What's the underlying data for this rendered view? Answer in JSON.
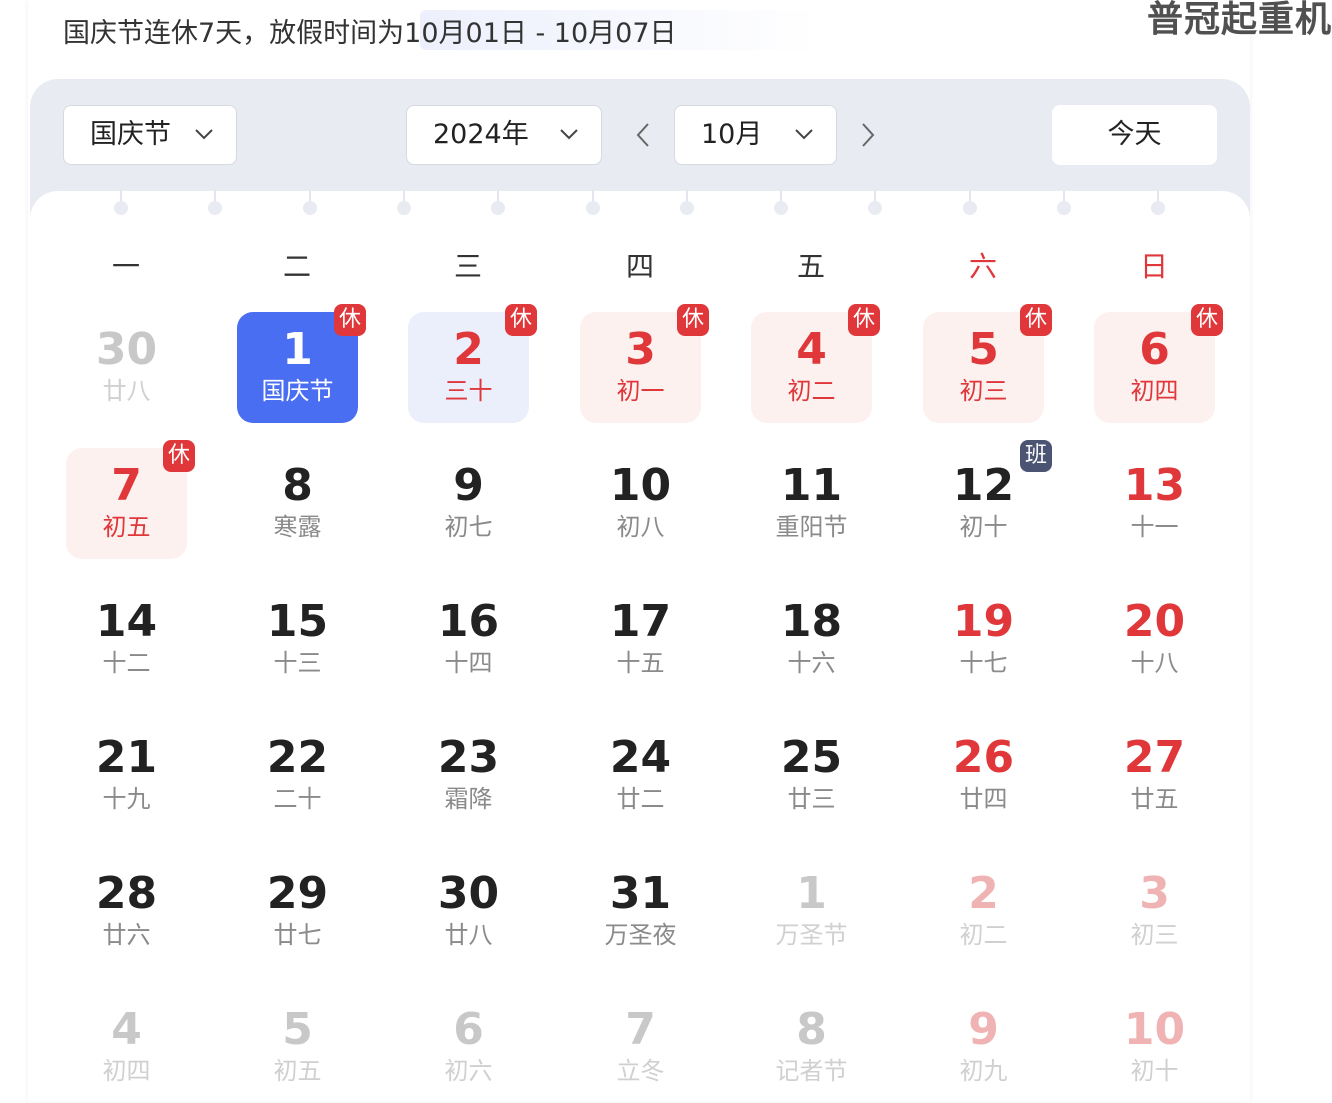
{
  "header": {
    "notice": "国庆节连休7天，放假时间为10月01日 - 10月07日",
    "watermark": "普冠起重机"
  },
  "toolbar": {
    "holiday_select": "国庆节",
    "year_select": "2024年",
    "month_select": "10月",
    "today_label": "今天",
    "prev_icon": "chevron-left-icon",
    "next_icon": "chevron-right-icon"
  },
  "weekdays": [
    "一",
    "二",
    "三",
    "四",
    "五",
    "六",
    "日"
  ],
  "badge_labels": {
    "rest": "休",
    "work": "班"
  },
  "colors": {
    "accent": "#4a6ef2",
    "holiday_red": "#e0373a",
    "holiday_bg": "#fdf1f0",
    "work_badge": "#4b5472",
    "toolbar_bg": "#e8ebf1"
  },
  "calendar": {
    "weeks": [
      [
        {
          "day": "30",
          "lunar": "廿八",
          "state": "other"
        },
        {
          "day": "1",
          "lunar": "国庆节",
          "state": "selected",
          "badge": "休"
        },
        {
          "day": "2",
          "lunar": "三十",
          "state": "selected2",
          "badge": "休"
        },
        {
          "day": "3",
          "lunar": "初一",
          "state": "holiday",
          "badge": "休"
        },
        {
          "day": "4",
          "lunar": "初二",
          "state": "holiday",
          "badge": "休"
        },
        {
          "day": "5",
          "lunar": "初三",
          "state": "holiday",
          "badge": "休"
        },
        {
          "day": "6",
          "lunar": "初四",
          "state": "holiday",
          "badge": "休"
        }
      ],
      [
        {
          "day": "7",
          "lunar": "初五",
          "state": "holiday",
          "badge": "休"
        },
        {
          "day": "8",
          "lunar": "寒露",
          "state": "normal"
        },
        {
          "day": "9",
          "lunar": "初七",
          "state": "normal"
        },
        {
          "day": "10",
          "lunar": "初八",
          "state": "normal"
        },
        {
          "day": "11",
          "lunar": "重阳节",
          "state": "normal"
        },
        {
          "day": "12",
          "lunar": "初十",
          "state": "normal",
          "badge": "班"
        },
        {
          "day": "13",
          "lunar": "十一",
          "state": "weekend"
        }
      ],
      [
        {
          "day": "14",
          "lunar": "十二",
          "state": "normal"
        },
        {
          "day": "15",
          "lunar": "十三",
          "state": "normal"
        },
        {
          "day": "16",
          "lunar": "十四",
          "state": "normal"
        },
        {
          "day": "17",
          "lunar": "十五",
          "state": "normal"
        },
        {
          "day": "18",
          "lunar": "十六",
          "state": "normal"
        },
        {
          "day": "19",
          "lunar": "十七",
          "state": "weekend"
        },
        {
          "day": "20",
          "lunar": "十八",
          "state": "weekend"
        }
      ],
      [
        {
          "day": "21",
          "lunar": "十九",
          "state": "normal"
        },
        {
          "day": "22",
          "lunar": "二十",
          "state": "normal"
        },
        {
          "day": "23",
          "lunar": "霜降",
          "state": "normal"
        },
        {
          "day": "24",
          "lunar": "廿二",
          "state": "normal"
        },
        {
          "day": "25",
          "lunar": "廿三",
          "state": "normal"
        },
        {
          "day": "26",
          "lunar": "廿四",
          "state": "weekend"
        },
        {
          "day": "27",
          "lunar": "廿五",
          "state": "weekend"
        }
      ],
      [
        {
          "day": "28",
          "lunar": "廿六",
          "state": "normal"
        },
        {
          "day": "29",
          "lunar": "廿七",
          "state": "normal"
        },
        {
          "day": "30",
          "lunar": "廿八",
          "state": "normal"
        },
        {
          "day": "31",
          "lunar": "万圣夜",
          "state": "normal"
        },
        {
          "day": "1",
          "lunar": "万圣节",
          "state": "other"
        },
        {
          "day": "2",
          "lunar": "初二",
          "state": "other-weekend"
        },
        {
          "day": "3",
          "lunar": "初三",
          "state": "other-weekend"
        }
      ],
      [
        {
          "day": "4",
          "lunar": "初四",
          "state": "other"
        },
        {
          "day": "5",
          "lunar": "初五",
          "state": "other"
        },
        {
          "day": "6",
          "lunar": "初六",
          "state": "other"
        },
        {
          "day": "7",
          "lunar": "立冬",
          "state": "other"
        },
        {
          "day": "8",
          "lunar": "记者节",
          "state": "other"
        },
        {
          "day": "9",
          "lunar": "初九",
          "state": "other-weekend"
        },
        {
          "day": "10",
          "lunar": "初十",
          "state": "other-weekend"
        }
      ]
    ]
  }
}
